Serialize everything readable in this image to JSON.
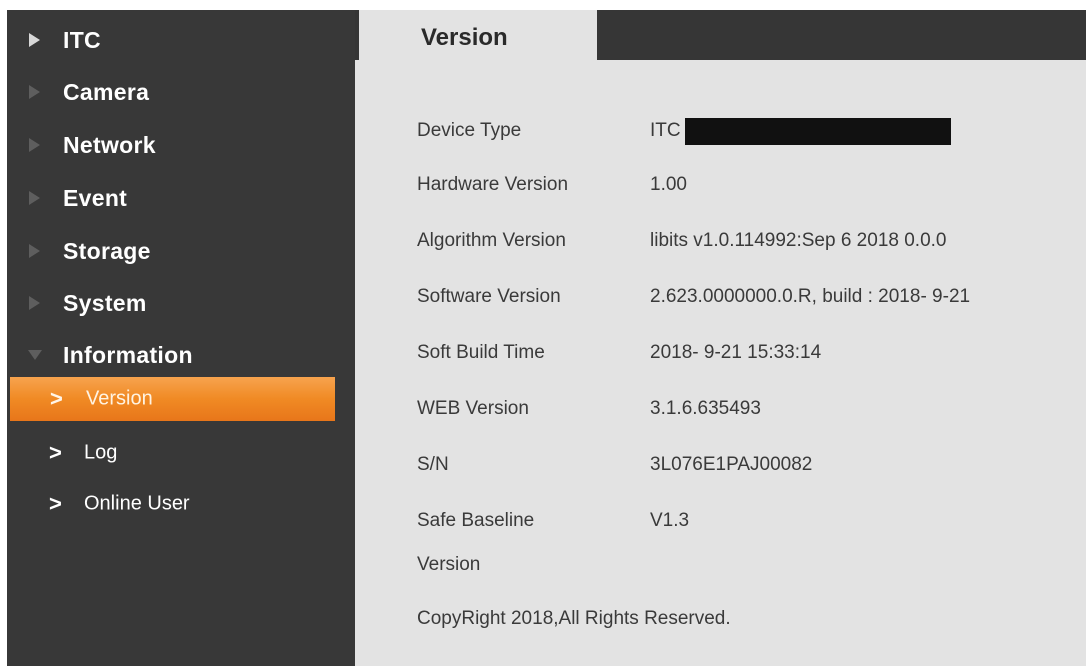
{
  "sidebar": {
    "menu": [
      {
        "label": "ITC",
        "state": "active"
      },
      {
        "label": "Camera",
        "state": "collapsed"
      },
      {
        "label": "Network",
        "state": "collapsed"
      },
      {
        "label": "Event",
        "state": "collapsed"
      },
      {
        "label": "Storage",
        "state": "collapsed"
      },
      {
        "label": "System",
        "state": "collapsed"
      },
      {
        "label": "Information",
        "state": "expanded"
      }
    ],
    "submenu": [
      {
        "label": "Version",
        "selected": true
      },
      {
        "label": "Log",
        "selected": false
      },
      {
        "label": "Online User",
        "selected": false
      }
    ],
    "chevron_glyph": ">"
  },
  "tab": {
    "label": "Version"
  },
  "version_info": {
    "rows": [
      {
        "label": "Device Type",
        "value": "ITC"
      },
      {
        "label": "Hardware Version",
        "value": "1.00"
      },
      {
        "label": "Algorithm Version",
        "value": "libits v1.0.114992:Sep  6 2018 0.0.0"
      },
      {
        "label": "Software Version",
        "value": "2.623.0000000.0.R, build : 2018- 9-21"
      },
      {
        "label": "Soft Build Time",
        "value": "2018- 9-21 15:33:14"
      },
      {
        "label": "WEB Version",
        "value": "3.1.6.635493"
      },
      {
        "label": "S/N",
        "value": "3L076E1PAJ00082"
      },
      {
        "label": "Safe Baseline",
        "value": "V1.3"
      }
    ],
    "safe_baseline_label_line2": "Version",
    "copyright": "CopyRight 2018,All Rights Reserved."
  },
  "colors": {
    "sidebar_bg": "#383838",
    "content_bg": "#e3e3e3",
    "accent_orange": "#f08a24",
    "redaction": "#111111"
  }
}
